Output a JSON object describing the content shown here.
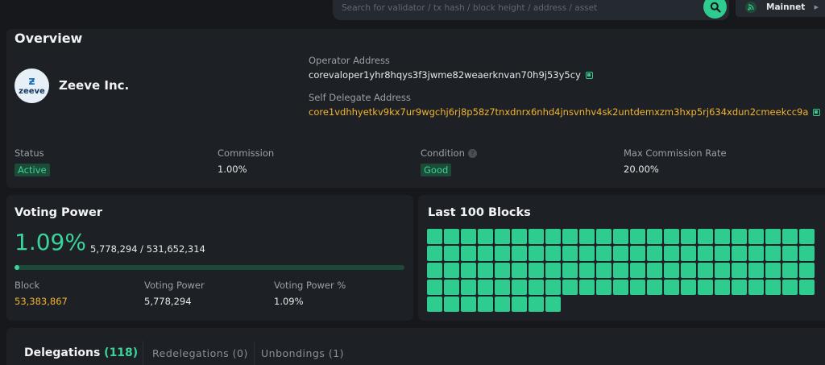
{
  "search": {
    "placeholder": "Search for validator / tx hash / block height / address / asset"
  },
  "network": {
    "label": "Mainnet"
  },
  "overview": {
    "title": "Overview",
    "validator_name": "Zeeve Inc.",
    "logo_text": "zeeve",
    "operator_label": "Operator Address",
    "operator_address": "corevaloper1yhr8hqys3f3jwme82weaerknvan70h9j53y5cy",
    "self_delegate_label": "Self Delegate Address",
    "self_delegate_address": "core1vdhhyetkv9kx7ur9wgchj6rj8p58z7tnxdnrx6nhd4jnsvnhv4sk2untdemxzm3hxp5rj634xdun2cmeekcc9a",
    "status_label": "Status",
    "status_value": "Active",
    "commission_label": "Commission",
    "commission_value": "1.00%",
    "condition_label": "Condition",
    "condition_value": "Good",
    "max_rate_label": "Max Commission Rate",
    "max_rate_value": "20.00%"
  },
  "voting_power": {
    "title": "Voting Power",
    "percent": "1.09%",
    "ratio": "5,778,294 / 531,652,314",
    "progress_fraction": 0.0109,
    "block_label": "Block",
    "block_value": "53,383,867",
    "vp_label": "Voting Power",
    "vp_value": "5,778,294",
    "vp_pct_label": "Voting Power %",
    "vp_pct_value": "1.09%"
  },
  "last_blocks": {
    "title": "Last 100 Blocks",
    "signed_count": 100,
    "color": "#2ecc8e"
  },
  "tabs": [
    {
      "label": "Delegations",
      "count": "(118)"
    },
    {
      "label": "Redelegations",
      "count": "(0)"
    },
    {
      "label": "Unbondings",
      "count": "(1)"
    }
  ],
  "colors": {
    "accent": "#3ad39a",
    "address_gold": "#f2b430"
  }
}
